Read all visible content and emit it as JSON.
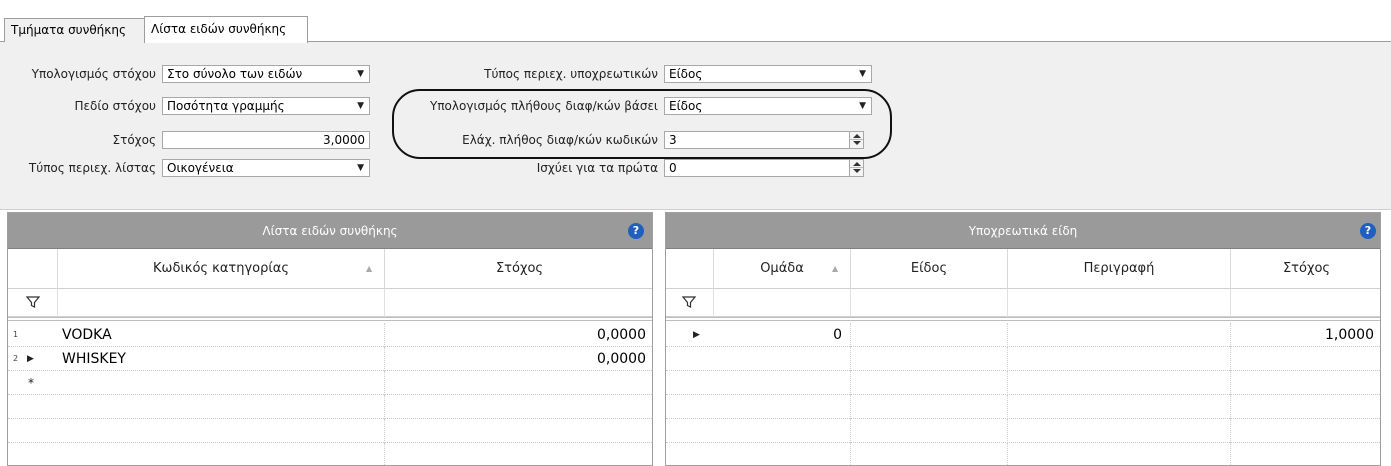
{
  "tabs": [
    {
      "label": "Τμήματα συνθήκης",
      "active": false
    },
    {
      "label": "Λίστα ειδών συνθήκης",
      "active": true
    }
  ],
  "form": {
    "target_calc": {
      "label": "Υπολογισμός στόχου",
      "value": "Στο σύνολο των ειδών"
    },
    "target_field": {
      "label": "Πεδίο στόχου",
      "value": "Ποσότητα γραμμής"
    },
    "target": {
      "label": "Στόχος",
      "value": "3,0000"
    },
    "list_content_type": {
      "label": "Τύπος περιεχ. λίστας",
      "value": "Οικογένεια"
    },
    "mandatory_content_type": {
      "label": "Τύπος περιεχ. υποχρεωτικών",
      "value": "Είδος"
    },
    "distinct_count_calc": {
      "label": "Υπολογισμός πλήθους διαφ/κών βάσει",
      "value": "Είδος"
    },
    "min_distinct_codes": {
      "label": "Ελάχ. πλήθος διαφ/κών κωδικών",
      "value": "3"
    },
    "applies_first": {
      "label": "Ισχύει για τα πρώτα",
      "value": "0"
    }
  },
  "left_grid": {
    "caption": "Λίστα ειδών συνθήκης",
    "columns": [
      "Κωδικός κατηγορίας",
      "Στόχος"
    ],
    "rows": [
      {
        "num": "1",
        "code": "VODKA",
        "target": "0,0000"
      },
      {
        "num": "2",
        "code": "WHISKEY",
        "target": "0,0000"
      }
    ]
  },
  "right_grid": {
    "caption": "Υποχρεωτικά είδη",
    "columns": [
      "Ομάδα",
      "Είδος",
      "Περιγραφή",
      "Στόχος"
    ],
    "rows": [
      {
        "group": "0",
        "item": "",
        "description": "",
        "target": "1,0000"
      }
    ]
  },
  "icons": {
    "help": "help-icon",
    "filter": "filter-icon",
    "dropdown": "chevron-down-icon",
    "spin": "spinner-icon",
    "current_row": "current-row-arrow-icon",
    "new_row": "new-row-star-icon"
  },
  "colors": {
    "caption_bar": "#9a9a9a",
    "help_icon": "#1f5fbf",
    "form_bg": "#f0f0f0"
  }
}
